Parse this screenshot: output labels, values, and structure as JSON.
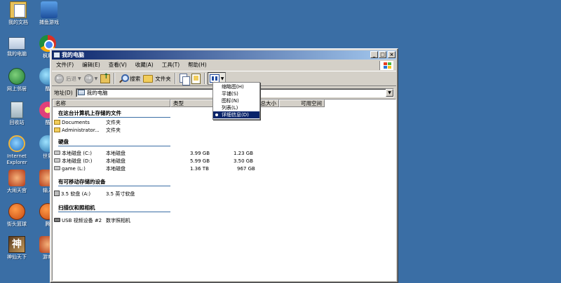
{
  "desktop": {
    "icons_left": [
      {
        "label": "我的文档",
        "icon": "my-documents-icon"
      },
      {
        "label": "我的电脑",
        "icon": "my-computer-icon"
      },
      {
        "label": "网上邻居",
        "icon": "network-places-icon"
      },
      {
        "label": "回收站",
        "icon": "recycle-bin-icon"
      },
      {
        "label": "Internet\nExplorer",
        "icon": "internet-explorer-icon"
      },
      {
        "label": "大闹天宫",
        "icon": "game-icon"
      },
      {
        "label": "街头篮球",
        "icon": "basketball-icon"
      },
      {
        "label": "神仙天下",
        "icon": "game-tile-icon"
      }
    ],
    "icons_right": [
      {
        "label": "捕鱼游戏",
        "icon": "fish-game-icon"
      },
      {
        "label": "枫利",
        "icon": "browser-icon"
      },
      {
        "label": "酷",
        "icon": "app-icon"
      },
      {
        "label": "酷",
        "icon": "app-icon"
      },
      {
        "label": "世界",
        "icon": "world-icon"
      },
      {
        "label": "输入",
        "icon": "input-icon"
      },
      {
        "label": "腾",
        "icon": "app-icon"
      },
      {
        "label": "游戏",
        "icon": "game-icon"
      }
    ]
  },
  "window": {
    "title": "我的电脑",
    "menu": [
      "文件(F)",
      "编辑(E)",
      "查看(V)",
      "收藏(A)",
      "工具(T)",
      "帮助(H)"
    ],
    "toolbar": {
      "back": "后退",
      "search": "搜索",
      "folders": "文件夹"
    },
    "address": {
      "label": "地址(D)",
      "value": "我的电脑"
    },
    "columns": [
      "名称",
      "类型",
      "总大小",
      "可用空间"
    ],
    "groups": [
      {
        "title": "在这台计算机上存储的文件",
        "items": [
          {
            "name": "Documents",
            "type": "文件夹",
            "total": "",
            "free": ""
          },
          {
            "name": "Administrator...",
            "type": "文件夹",
            "total": "",
            "free": ""
          }
        ]
      },
      {
        "title": "硬盘",
        "items": [
          {
            "name": "本地磁盘 (C:)",
            "type": "本地磁盘",
            "total": "3.99 GB",
            "free": "1.23 GB"
          },
          {
            "name": "本地磁盘 (D:)",
            "type": "本地磁盘",
            "total": "5.99 GB",
            "free": "3.50 GB"
          },
          {
            "name": "game (L:)",
            "type": "本地磁盘",
            "total": "1.36 TB",
            "free": "967 GB"
          }
        ]
      },
      {
        "title": "有可移动存储的设备",
        "items": [
          {
            "name": "3.5 软盘 (A:)",
            "type": "3.5 英寸软盘",
            "total": "",
            "free": ""
          }
        ]
      },
      {
        "title": "扫描仪和照相机",
        "items": [
          {
            "name": "USB 视频设备 #2",
            "type": "数字照相机",
            "total": "",
            "free": ""
          }
        ]
      }
    ]
  },
  "view_menu": {
    "items": [
      "缩略图(H)",
      "平铺(S)",
      "图标(N)",
      "列表(L)",
      "详细信息(D)"
    ],
    "selected": "详细信息(D)"
  }
}
